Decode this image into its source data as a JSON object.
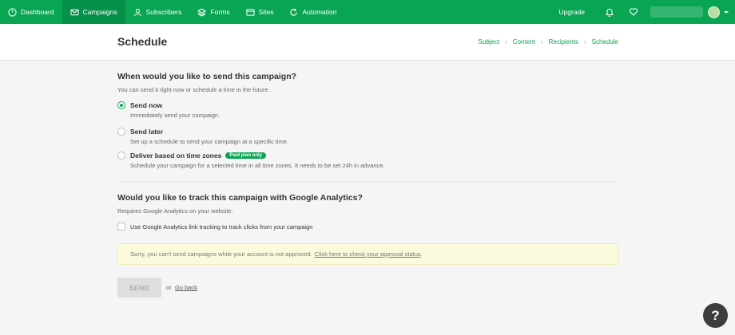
{
  "nav": {
    "items": [
      {
        "label": "Dashboard",
        "icon": "dashboard-icon"
      },
      {
        "label": "Campaigns",
        "icon": "envelope-icon",
        "active": true
      },
      {
        "label": "Subscribers",
        "icon": "user-icon"
      },
      {
        "label": "Forms",
        "icon": "layers-icon"
      },
      {
        "label": "Sites",
        "icon": "browser-icon"
      },
      {
        "label": "Automation",
        "icon": "refresh-icon"
      }
    ],
    "upgrade_label": "Upgrade",
    "bell_icon": "bell-icon",
    "heart_icon": "heart-icon",
    "brand_color": "#09a552"
  },
  "header": {
    "title": "Schedule",
    "breadcrumb": [
      "Subject",
      "Content",
      "Recipients",
      "Schedule"
    ]
  },
  "schedule": {
    "title": "When would you like to send this campaign?",
    "hint": "You can send it right now or schedule a time in the future.",
    "options": [
      {
        "label": "Send now",
        "desc": "Immediately send your campaign.",
        "checked": true
      },
      {
        "label": "Send later",
        "desc": "Set up a schedule to send your campaign at a specific time.",
        "checked": false
      },
      {
        "label": "Deliver based on time zones",
        "badge": "Paid plan only",
        "desc": "Schedule your campaign for a selected time in all time zones. It needs to be set 24h in advance.",
        "checked": false
      }
    ]
  },
  "analytics": {
    "title": "Would you like to track this campaign with Google Analytics?",
    "hint": "Requires Google Analytics on your website.",
    "checkbox_label": "Use Google Analytics link tracking to track clicks from your campaign",
    "checked": false
  },
  "alert": {
    "text": "Sorry, you can't send campaigns while your account is not approved.",
    "link": "Click here to check your approval status",
    "after": "."
  },
  "actions": {
    "send_label": "SEND",
    "or_label": "or",
    "back_label": "Go back"
  },
  "help": {
    "label": "?"
  }
}
